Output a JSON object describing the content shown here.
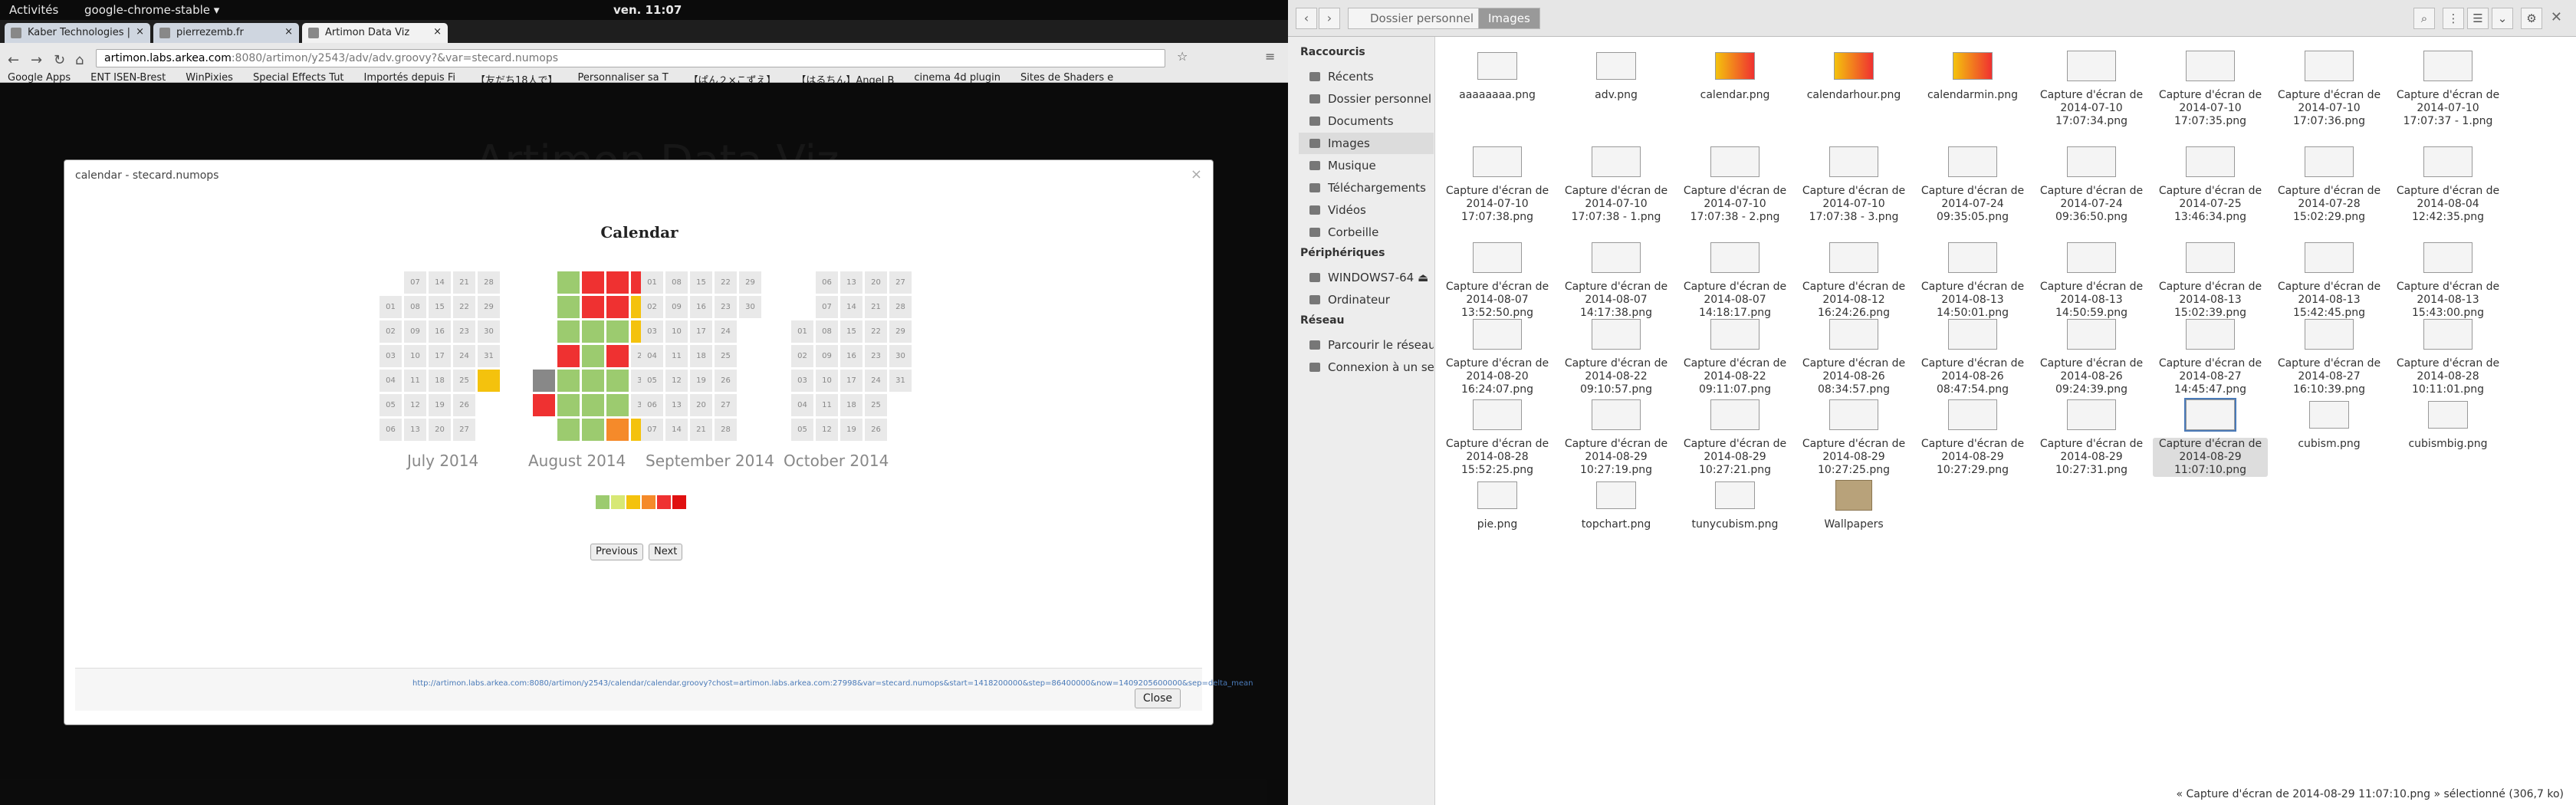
{
  "topbar": {
    "activities": "Activités",
    "app_menu": "google-chrome-stable ▾",
    "clock": "ven. 11:07",
    "tray": [
      "🔊",
      "⏻ ▾"
    ]
  },
  "chrome": {
    "tabs": [
      {
        "label": "Kaber Technologies |"
      },
      {
        "label": "pierrezemb.fr"
      },
      {
        "label": "Artimon Data Viz"
      }
    ],
    "url": {
      "host": "artimon.labs.arkea.com",
      "path": ":8080/artimon/y2543/adv/adv.groovy?&var=stecard.numops"
    },
    "bookmarks": [
      "Google Apps",
      "ENT ISEN-Brest",
      "WinPixies",
      "Special Effects Tut",
      "Importés depuis Fi",
      "【友だち18人で】",
      "Personnaliser sa T",
      "【ぱん２×こずえ】",
      "【はるちん】Angel B",
      "cinema 4d plugin",
      "Sites de Shaders e"
    ],
    "bg_title": "Artimon Data Viz",
    "modal": {
      "header": "calendar - stecard.numops",
      "title": "Calendar",
      "months": [
        "July 2014",
        "August 2014",
        "September 2014",
        "October 2014"
      ],
      "legend_colors": [
        "#9ccb6f",
        "#d7e875",
        "#f4c20d",
        "#f58a2a",
        "#ef3131",
        "#e01010"
      ],
      "prev": "Previous",
      "next": "Next",
      "link": "http://artimon.labs.arkea.com:8080/artimon/y2543/calendar/calendar.groovy?chost=artimon.labs.arkea.com:27998&var=stecard.numops&start=1418200000&step=86400000&now=1409205600000&sep=delta_mean",
      "close": "Close"
    }
  },
  "calendar": {
    "july": [
      7,
      14,
      21,
      28,
      1,
      8,
      15,
      22,
      29,
      2,
      9,
      16,
      23,
      30,
      3,
      10,
      17,
      24,
      31,
      4,
      11,
      18,
      25,
      5,
      12,
      19,
      26,
      6,
      13,
      20,
      27
    ],
    "august_highlight": [
      "red",
      "red",
      "red",
      "red",
      "orange"
    ]
  },
  "nautilus": {
    "crumbs": [
      "Dossier personnel",
      "Images"
    ],
    "sidebar": [
      {
        "type": "head",
        "label": "Raccourcis"
      },
      {
        "type": "item",
        "label": "Récents"
      },
      {
        "type": "item",
        "label": "Dossier personnel"
      },
      {
        "type": "item",
        "label": "Documents"
      },
      {
        "type": "item",
        "label": "Images",
        "selected": true
      },
      {
        "type": "item",
        "label": "Musique"
      },
      {
        "type": "item",
        "label": "Téléchargements"
      },
      {
        "type": "item",
        "label": "Vidéos"
      },
      {
        "type": "item",
        "label": "Corbeille"
      },
      {
        "type": "head",
        "label": "Périphériques"
      },
      {
        "type": "item",
        "label": "WINDOWS7-64 ⏏"
      },
      {
        "type": "item",
        "label": "Ordinateur"
      },
      {
        "type": "head",
        "label": "Réseau"
      },
      {
        "type": "item",
        "label": "Parcourir le réseau"
      },
      {
        "type": "item",
        "label": "Connexion à un ser..."
      }
    ],
    "files": [
      [
        "aaaaaaaa.png"
      ],
      [
        "adv.png"
      ],
      [
        "calendar.png"
      ],
      [
        "calendarhour.png"
      ],
      [
        "calendarmin.png"
      ],
      [
        "Capture d'écran de",
        "2014-07-10",
        "17:07:34.png"
      ],
      [
        "Capture d'écran de",
        "2014-07-10",
        "17:07:35.png"
      ],
      [
        "Capture d'écran de",
        "2014-07-10",
        "17:07:36.png"
      ],
      [
        "Capture d'écran de",
        "2014-07-10",
        "17:07:37 - 1.png"
      ],
      [
        "Capture d'écran de",
        "2014-07-10",
        "17:07:38.png"
      ],
      [
        "Capture d'écran de",
        "2014-07-10",
        "17:07:38 - 1.png"
      ],
      [
        "Capture d'écran de",
        "2014-07-10",
        "17:07:38 - 2.png"
      ],
      [
        "Capture d'écran de",
        "2014-07-10",
        "17:07:38 - 3.png"
      ],
      [
        "Capture d'écran de",
        "2014-07-24",
        "09:35:05.png"
      ],
      [
        "Capture d'écran de",
        "2014-07-24",
        "09:36:50.png"
      ],
      [
        "Capture d'écran de",
        "2014-07-25",
        "13:46:34.png"
      ],
      [
        "Capture d'écran de",
        "2014-07-28",
        "15:02:29.png"
      ],
      [
        "Capture d'écran de",
        "2014-08-04",
        "12:42:35.png"
      ],
      [
        "Capture d'écran de",
        "2014-08-07",
        "13:52:50.png"
      ],
      [
        "Capture d'écran de",
        "2014-08-07",
        "14:17:38.png"
      ],
      [
        "Capture d'écran de",
        "2014-08-07",
        "14:18:17.png"
      ],
      [
        "Capture d'écran de",
        "2014-08-12",
        "16:24:26.png"
      ],
      [
        "Capture d'écran de",
        "2014-08-13",
        "14:50:01.png"
      ],
      [
        "Capture d'écran de",
        "2014-08-13",
        "14:50:59.png"
      ],
      [
        "Capture d'écran de",
        "2014-08-13",
        "15:02:39.png"
      ],
      [
        "Capture d'écran de",
        "2014-08-13",
        "15:42:45.png"
      ],
      [
        "Capture d'écran de",
        "2014-08-13",
        "15:43:00.png"
      ],
      [
        "Capture d'écran de",
        "2014-08-20",
        "16:24:07.png"
      ],
      [
        "Capture d'écran de",
        "2014-08-22",
        "09:10:57.png"
      ],
      [
        "Capture d'écran de",
        "2014-08-22",
        "09:11:07.png"
      ],
      [
        "Capture d'écran de",
        "2014-08-26",
        "08:34:57.png"
      ],
      [
        "Capture d'écran de",
        "2014-08-26",
        "08:47:54.png"
      ],
      [
        "Capture d'écran de",
        "2014-08-26",
        "09:24:39.png"
      ],
      [
        "Capture d'écran de",
        "2014-08-27",
        "14:45:47.png"
      ],
      [
        "Capture d'écran de",
        "2014-08-27",
        "16:10:39.png"
      ],
      [
        "Capture d'écran de",
        "2014-08-28",
        "10:11:01.png"
      ],
      [
        "Capture d'écran de",
        "2014-08-28",
        "15:52:25.png"
      ],
      [
        "Capture d'écran de",
        "2014-08-29",
        "10:27:19.png"
      ],
      [
        "Capture d'écran de",
        "2014-08-29",
        "10:27:21.png"
      ],
      [
        "Capture d'écran de",
        "2014-08-29",
        "10:27:25.png"
      ],
      [
        "Capture d'écran de",
        "2014-08-29",
        "10:27:29.png"
      ],
      [
        "Capture d'écran de",
        "2014-08-29",
        "10:27:31.png"
      ],
      [
        "Capture d'écran de",
        "2014-08-29",
        "11:07:10.png"
      ],
      [
        "cubism.png"
      ],
      [
        "cubismbig.png"
      ],
      [
        "pie.png"
      ],
      [
        "topchart.png"
      ],
      [
        "tunycubism.png"
      ],
      [
        "Wallpapers"
      ]
    ],
    "selected_index": 42,
    "status": "« Capture d'écran de 2014-08-29 11:07:10.png » sélectionné (306,7 ko)"
  }
}
